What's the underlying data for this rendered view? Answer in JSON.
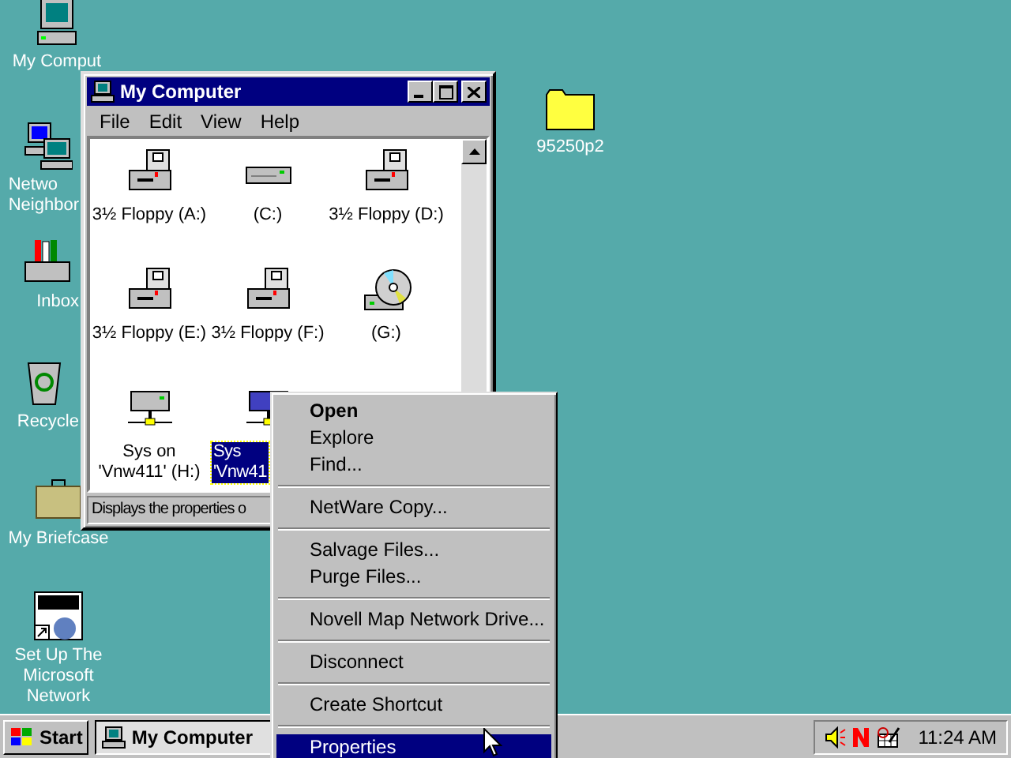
{
  "desktop_icons": [
    {
      "kind": "computer",
      "label": "My Comput"
    },
    {
      "kind": "network",
      "label": "Netwo\nNeighbor"
    },
    {
      "kind": "inbox",
      "label": "Inbox"
    },
    {
      "kind": "recycle",
      "label": "Recycle"
    },
    {
      "kind": "briefcase",
      "label": "My Briefcase"
    },
    {
      "kind": "msn",
      "label": "Set Up The\nMicrosoft\nNetwork"
    },
    {
      "kind": "folder",
      "label": "95250p2"
    }
  ],
  "window": {
    "title": "My Computer",
    "menu": [
      "File",
      "Edit",
      "View",
      "Help"
    ],
    "items": [
      {
        "kind": "floppy",
        "label": "3½ Floppy (A:)",
        "selected": false
      },
      {
        "kind": "harddisk",
        "label": "(C:)",
        "selected": false
      },
      {
        "kind": "floppy",
        "label": "3½ Floppy (D:)",
        "selected": false
      },
      {
        "kind": "floppy",
        "label": "3½ Floppy (E:)",
        "selected": false
      },
      {
        "kind": "floppy",
        "label": "3½ Floppy (F:)",
        "selected": false
      },
      {
        "kind": "cdrom",
        "label": "(G:)",
        "selected": false
      },
      {
        "kind": "netdrive",
        "label": "Sys on\n'Vnw411' (H:)",
        "selected": false
      },
      {
        "kind": "netdrive",
        "label": "Sys\n'Vnw41",
        "selected": true
      }
    ],
    "status_bar": "Displays the properties o"
  },
  "context_menu": [
    {
      "kind": "item",
      "label": "Open",
      "default": true,
      "selected": false
    },
    {
      "kind": "item",
      "label": "Explore",
      "default": false,
      "selected": false
    },
    {
      "kind": "item",
      "label": "Find...",
      "default": false,
      "selected": false
    },
    {
      "kind": "separator"
    },
    {
      "kind": "item",
      "label": "NetWare Copy...",
      "default": false,
      "selected": false
    },
    {
      "kind": "separator"
    },
    {
      "kind": "item",
      "label": "Salvage Files...",
      "default": false,
      "selected": false
    },
    {
      "kind": "item",
      "label": "Purge Files...",
      "default": false,
      "selected": false
    },
    {
      "kind": "separator"
    },
    {
      "kind": "item",
      "label": "Novell Map Network Drive...",
      "default": false,
      "selected": false
    },
    {
      "kind": "separator"
    },
    {
      "kind": "item",
      "label": "Disconnect",
      "default": false,
      "selected": false
    },
    {
      "kind": "separator"
    },
    {
      "kind": "item",
      "label": "Create Shortcut",
      "default": false,
      "selected": false
    },
    {
      "kind": "separator"
    },
    {
      "kind": "item",
      "label": "Properties",
      "default": false,
      "selected": true
    }
  ],
  "taskbar": {
    "start": "Start",
    "tasks": [
      {
        "label": "My Computer",
        "selected": true
      }
    ],
    "clock": "11:24 AM"
  }
}
